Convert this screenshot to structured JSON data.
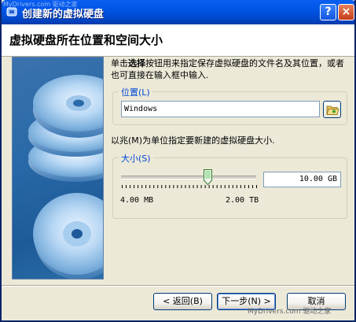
{
  "window": {
    "title": "创建新的虚拟硬盘",
    "watermark_top": "MyDrivers.com 驱动之家",
    "help_label": "?",
    "close_label": "×"
  },
  "header": {
    "title": "虚拟硬盘所在位置和空间大小"
  },
  "instructions": {
    "prefix": "单击",
    "bold": "选择",
    "suffix": "按钮用来指定保存虚拟硬盘的文件名及其位置，或者也可直接在输入框中输入."
  },
  "location": {
    "legend": "位置(L)",
    "value": "Windows"
  },
  "size": {
    "description": "以兆(M)为单位指定要新建的虚拟硬盘大小.",
    "legend": "大小(S)",
    "value": "10.00 GB",
    "min_label": "4.00 MB",
    "max_label": "2.00 TB",
    "slider_fraction": 0.64
  },
  "buttons": {
    "back": "< 返回(B)",
    "next": "下一步(N) >",
    "cancel": "取消"
  },
  "watermark_bottom": "MyDrivers.com 驱动之家"
}
